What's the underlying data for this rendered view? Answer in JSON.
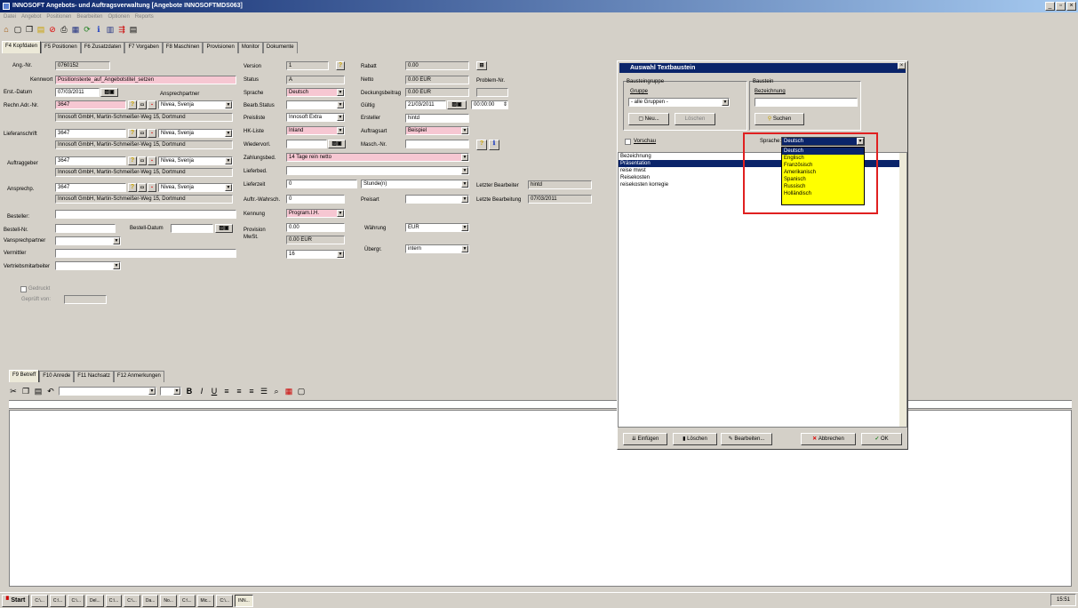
{
  "window": {
    "title": "INNOSOFT Angebots- und Auftragsverwaltung [Angebote INNOSOFTMDS063]"
  },
  "menu": [
    "Datei",
    "Angebot",
    "Positionen",
    "Bearbeiten",
    "Optionen",
    "Reports"
  ],
  "tabs": [
    "F4 Kopfdaten",
    "F5 Positionen",
    "F6 Zusatzdaten",
    "F7 Vorgaben",
    "F8 Maschinen",
    "Provisionen",
    "Monitor",
    "Dokumente"
  ],
  "form": {
    "angnr_label": "Ang.-Nr.",
    "angnr": "0760152",
    "kennwort_label": "Kennwort",
    "kennwort": "Positionstexte_auf_Angebotstitel_setzen",
    "erstdatum_label": "Erst.-Datum",
    "erstdatum": "07/03/2011",
    "ansprechpartner_label": "Ansprechpartner",
    "rechnadr_label": "Rechn.Adr.-Nr.",
    "rechnadr": "3647",
    "rechnadr_ap": "Nivea, Svenja",
    "rechnadr_addr": "Innosoft GmbH, Martin-Schmeißer-Weg 15, Dortmund",
    "lief_label": "Lieferanschrift",
    "lief": "3647",
    "lief_ap": "Nivea, Svenja",
    "lief_addr": "Innosoft GmbH, Martin-Schmeißer-Weg 15, Dortmund",
    "auftr_label": "Auftraggeber",
    "auftr": "3647",
    "auftr_ap": "Nivea, Svenja",
    "auftr_addr": "Innosoft GmbH, Martin-Schmeißer-Weg 15, Dortmund",
    "ansp_label": "Ansprechp.",
    "ansp": "3647",
    "ansp_ap": "Nivea, Svenja",
    "ansp_addr": "Innosoft GmbH, Martin-Schmeißer-Weg 15, Dortmund",
    "besteller_label": "Besteller:",
    "bestellnr_label": "Bestell-Nr.",
    "bestelldatum_label": "Bestell-Datum",
    "vanspr_label": "Vansprechpartner",
    "vermittler_label": "Vermittler",
    "vertrieb_label": "Vertriebsmitarbeiter",
    "version_label": "Version",
    "version": "1",
    "status_label": "Status",
    "status": "A",
    "sprache_label": "Sprache",
    "sprache": "Deutsch",
    "bearbstatus_label": "Bearb.Status",
    "preisliste_label": "Preisliste",
    "preisliste": "Innosoft Extra",
    "hkliste_label": "HK-Liste",
    "hkliste": "Inland",
    "wiedervorl_label": "Wiedervorl.",
    "zahlung_label": "Zahlungsbed.",
    "zahlung": "14 Tage rein netto",
    "lieferbed_label": "Lieferbed.",
    "lieferzeit_label": "Lieferzeit",
    "lieferzeit": "0",
    "lieferzeit_unit": "Stunde(n)",
    "auftrwahr_label": "Auftr.-Wahrsch.",
    "auftrwahr": "0",
    "kennung_label": "Kennung",
    "kennung": "Program.I.H.",
    "provision_label": "Provision",
    "provision": "0.00",
    "mwst_label": "MwSt.",
    "mwst": "0.00 EUR",
    "mwst_pct": "16",
    "rabatt_label": "Rabatt",
    "rabatt": "0.00",
    "netto_label": "Netto",
    "netto": "0.00 EUR",
    "deckung_label": "Deckungsbeitrag",
    "deckung": "0.00 EUR",
    "gueltig_label": "Gültig",
    "gueltig": "21/03/2011",
    "gueltig_time": "00:00:00",
    "ersteller_label": "Ersteller",
    "ersteller": "hintd",
    "auftragsart_label": "Auftragsart",
    "auftragsart": "Beispiel",
    "maschnr_label": "Masch.-Nr.",
    "preisart_label": "Preisart",
    "waehrung_label": "Währung",
    "waehrung": "EUR",
    "uebergr_label": "Übergr.",
    "uebergr": "intern",
    "problem_label": "Problem-Nr.",
    "letzterbearb_label": "Letzter Bearbeiter",
    "letzterbearb": "hintd",
    "letztebearb_label": "Letzte Bearbeitung",
    "letztebearb": "07/03/2011",
    "gedruckt_label": "Gedruckt",
    "geprueft_label": "Geprüft von:"
  },
  "bottom_tabs": [
    "F9 Betreff",
    "F10 Anrede",
    "F11 Nachsatz",
    "F12 Anmerkungen"
  ],
  "dialog": {
    "title": "Auswahl Textbaustein",
    "grp1": "Bausteingruppe",
    "gruppe_label": "Gruppe",
    "gruppe": "- alle Gruppen -",
    "neu": "Neu...",
    "loeschen_g": "Löschen",
    "grp2": "Baustein",
    "bezeichnung_label": "Bezeichnung",
    "suchen": "Suchen",
    "vorschau": "Vorschau",
    "sprache_label": "Sprache:",
    "sprache": "Deutsch",
    "sprachen": [
      "Deutsch",
      "Englisch",
      "Französisch",
      "Amerikanisch",
      "Spanisch",
      "Russisch",
      "Holländisch"
    ],
    "list_header": "Bezeichnung",
    "items": [
      "Präsentation",
      "reise mwst",
      "Reisekosten",
      "reisekosten korregie"
    ],
    "einfuegen": "Einfügen",
    "loeschen": "Löschen",
    "bearbeiten": "Bearbeiten...",
    "abbrechen": "Abbrechen",
    "ok": "OK"
  },
  "taskbar": {
    "start": "Start",
    "items": [
      "C:\\...",
      "C:\\...",
      "C:\\...",
      "Del...",
      "C:\\...",
      "C:\\...",
      "Da...",
      "No...",
      "C:\\...",
      "Mic...",
      "C:\\...",
      "INN..."
    ],
    "clock": "15:51"
  }
}
